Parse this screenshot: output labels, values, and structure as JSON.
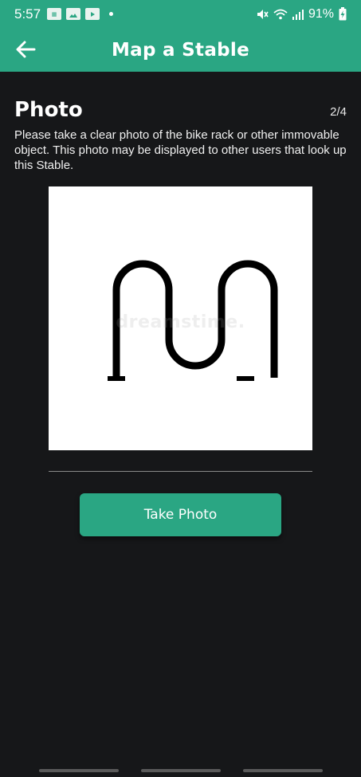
{
  "status_bar": {
    "time": "5:57",
    "notification_icons": [
      "news-icon",
      "gallery-icon",
      "youtube-icon"
    ],
    "battery_percent": "91%"
  },
  "app_bar": {
    "title": "Map a Stable",
    "back_icon": "arrow-left-icon"
  },
  "step": {
    "heading": "Photo",
    "counter": "2/4",
    "instructions": "Please take a clear photo of the bike rack or other immovable object. This photo may be displayed to other users that look up this Stable."
  },
  "photo": {
    "subject": "bike-rack-image",
    "watermark": "dreamstime."
  },
  "actions": {
    "take_photo_label": "Take Photo"
  },
  "colors": {
    "accent": "#2aa683",
    "background": "#161719"
  }
}
